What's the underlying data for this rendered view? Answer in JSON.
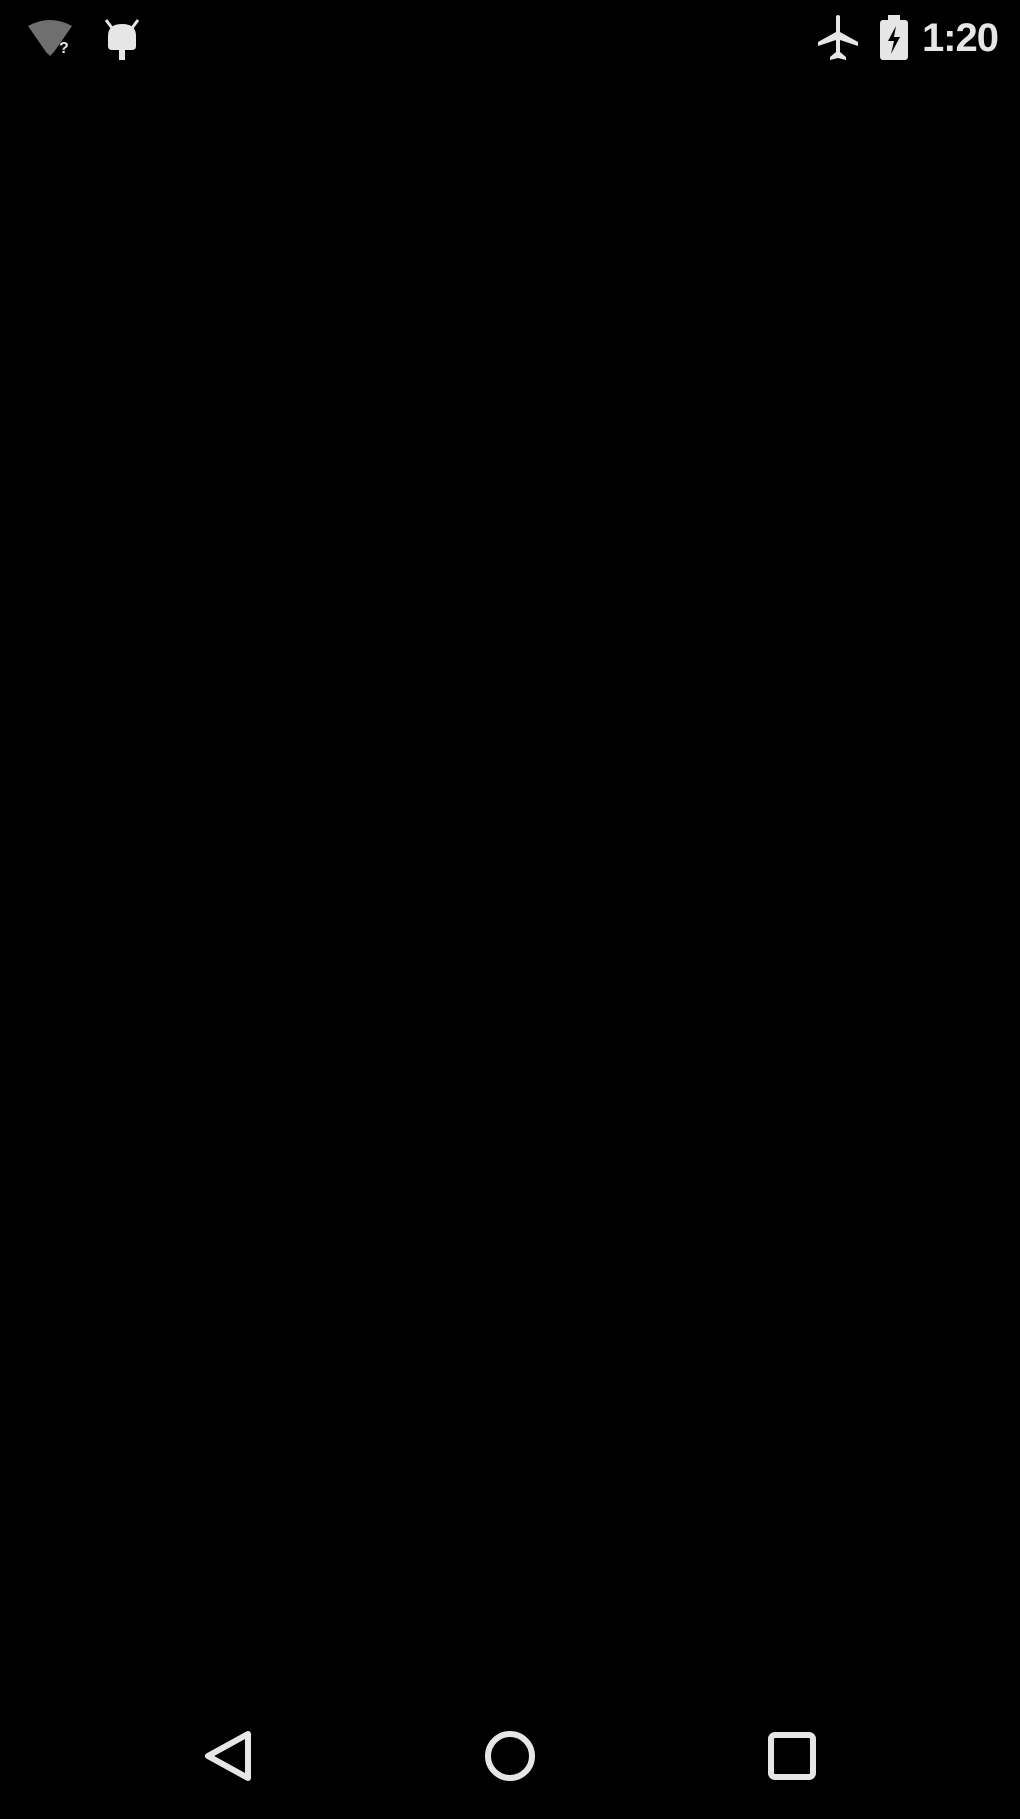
{
  "status_bar": {
    "time": "1:20",
    "left_icons": [
      "wifi-no-internet-icon",
      "android-debug-icon"
    ],
    "right_icons": [
      "airplane-mode-icon",
      "battery-charging-icon"
    ]
  },
  "nav_bar": {
    "buttons": [
      "back-icon",
      "home-icon",
      "recents-icon"
    ]
  },
  "colors": {
    "background": "#000000",
    "icon": "#e6e6e6",
    "icon_dim": "#9a9a9a"
  }
}
